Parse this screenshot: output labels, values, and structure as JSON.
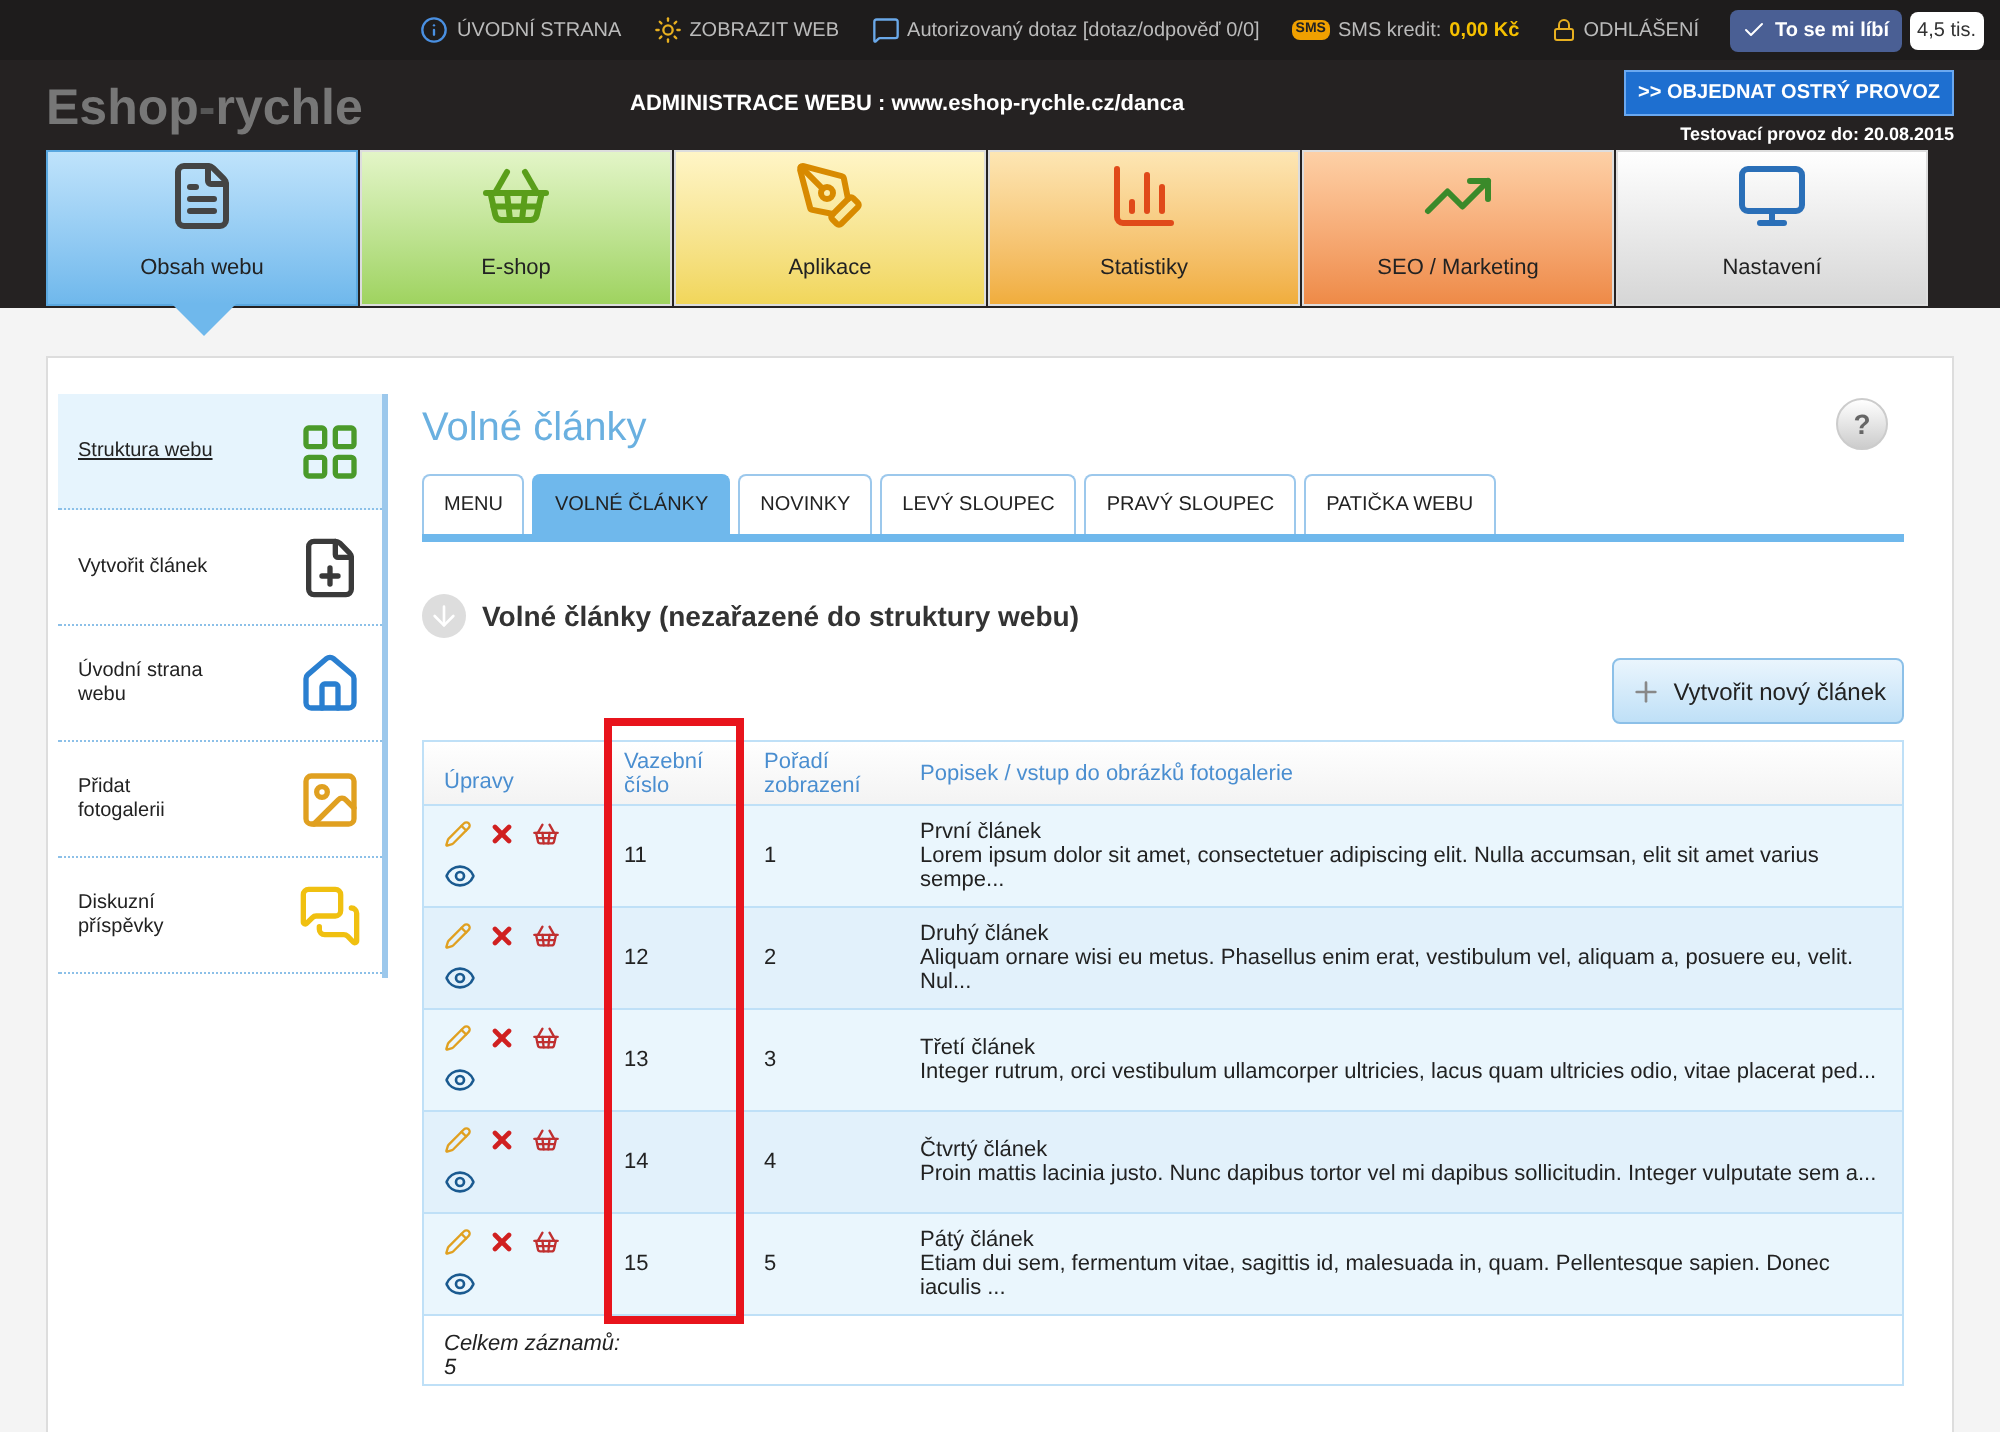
{
  "top_bar": {
    "links": [
      {
        "label": "ÚVODNÍ STRANA"
      },
      {
        "label": "ZOBRAZIT WEB"
      },
      {
        "label": "Autorizovaný dotaz [dotaz/odpověď 0/0]"
      }
    ],
    "sms": {
      "badge": "SMS",
      "label": "SMS kredit:",
      "value": "0,00 Kč"
    },
    "logout": "ODHLÁŠENÍ",
    "like": {
      "label": "To se mi líbí",
      "count": "4,5 tis."
    }
  },
  "header": {
    "logo_a": "Eshop",
    "logo_sep": "-",
    "logo_b": "rychle",
    "title": "ADMINISTRACE WEBU : www.eshop-rychle.cz/danca",
    "order_button": ">> OBJEDNAT OSTRÝ PROVOZ",
    "test_note": "Testovací provoz do: 20.08.2015"
  },
  "nav_tiles": [
    {
      "label": "Obsah webu",
      "selected": true
    },
    {
      "label": "E-shop",
      "selected": false
    },
    {
      "label": "Aplikace",
      "selected": false
    },
    {
      "label": "Statistiky",
      "selected": false
    },
    {
      "label": "SEO / Marketing",
      "selected": false
    },
    {
      "label": "Nastavení",
      "selected": false
    }
  ],
  "sidebar": {
    "items": [
      {
        "label": "Struktura webu",
        "selected": true
      },
      {
        "label": "Vytvořit článek",
        "selected": false
      },
      {
        "label": "Úvodní strana webu",
        "selected": false
      },
      {
        "label": "Přidat fotogalerii",
        "selected": false
      },
      {
        "label": "Diskuzní příspěvky",
        "selected": false
      }
    ]
  },
  "page_title": "Volné články",
  "help": "?",
  "tabs": [
    {
      "label": "MENU",
      "selected": false
    },
    {
      "label": "VOLNÉ ČLÁNKY",
      "selected": true
    },
    {
      "label": "NOVINKY",
      "selected": false
    },
    {
      "label": "LEVÝ SLOUPEC",
      "selected": false
    },
    {
      "label": "PRAVÝ SLOUPEC",
      "selected": false
    },
    {
      "label": "PATIČKA WEBU",
      "selected": false
    }
  ],
  "section_title": "Volné články (nezařazené do struktury webu)",
  "create_button": "Vytvořit nový článek",
  "table": {
    "columns": [
      {
        "label": "Úpravy",
        "highlighted": false
      },
      {
        "label": "Vazební číslo",
        "highlighted": true
      },
      {
        "label": "Pořadí zobrazení",
        "highlighted": false
      },
      {
        "label": "Popisek / vstup do obrázků fotogalerie",
        "highlighted": false
      }
    ],
    "rows": [
      {
        "id": "11",
        "order": "1",
        "title": "První článek",
        "text": "Lorem ipsum dolor sit amet, consectetuer adipiscing elit. Nulla accumsan, elit sit amet varius sempe..."
      },
      {
        "id": "12",
        "order": "2",
        "title": "Druhý článek",
        "text": "Aliquam ornare wisi eu metus. Phasellus enim erat, vestibulum vel, aliquam a, posuere eu, velit. Nul..."
      },
      {
        "id": "13",
        "order": "3",
        "title": "Třetí článek",
        "text": "Integer rutrum, orci vestibulum ullamcorper ultricies, lacus quam ultricies odio, vitae placerat ped..."
      },
      {
        "id": "14",
        "order": "4",
        "title": "Čtvrtý článek",
        "text": "Proin mattis lacinia justo. Nunc dapibus tortor vel mi dapibus sollicitudin. Integer vulputate sem a..."
      },
      {
        "id": "15",
        "order": "5",
        "title": "Pátý článek",
        "text": "Etiam dui sem, fermentum vitae, sagittis id, malesuada in, quam. Pellentesque sapien. Donec iaculis ..."
      }
    ],
    "total_label": "Celkem záznamů:",
    "total_value": "5"
  }
}
